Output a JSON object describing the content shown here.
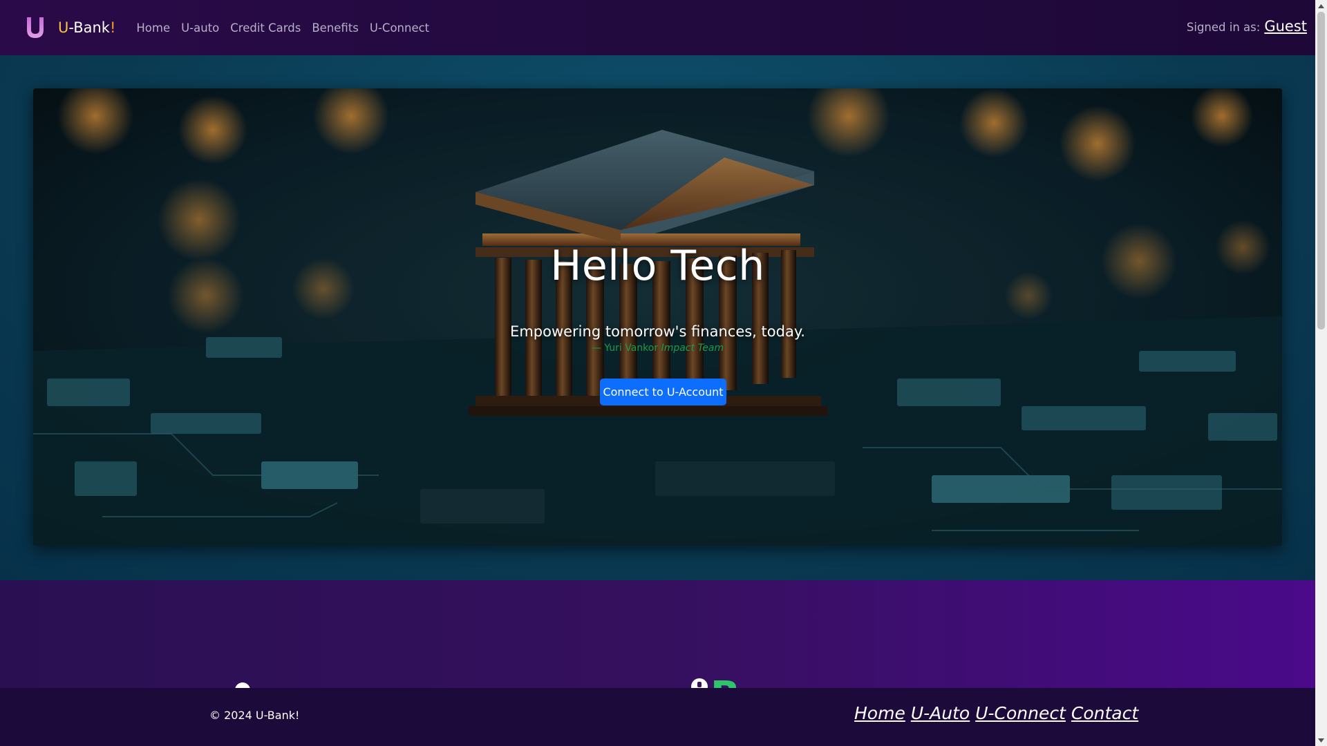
{
  "navbar": {
    "brand_prefix": "U",
    "brand_middle": "-Bank",
    "brand_suffix": "!",
    "links": [
      {
        "label": "Home"
      },
      {
        "label": "U-auto"
      },
      {
        "label": "Credit Cards"
      },
      {
        "label": "Benefits"
      },
      {
        "label": "U-Connect"
      }
    ],
    "signed_in_label": "Signed in as:",
    "signed_in_user": "Guest"
  },
  "hero": {
    "title": "Hello Tech",
    "quote": "Empowering tomorrow's finances, today.",
    "attribution_dash": "— Yuri Vankor",
    "attribution_team": "Impact Team",
    "button_label": "Connect to U-Account"
  },
  "footer": {
    "copyright": "© 2024 U-Bank!",
    "links": [
      {
        "label": "Home"
      },
      {
        "label": "U-Auto"
      },
      {
        "label": "U-Connect"
      },
      {
        "label": "Contact"
      }
    ]
  },
  "colors": {
    "accent_button": "#0d6efd",
    "navbar_bg": "#240a42",
    "hero_section_bg": "#0a3a52",
    "footer_bg": "#1c0a3a",
    "attribution": "#1f9a4a",
    "lower_heading": "#2ec46a"
  },
  "icons": {
    "brand_logo": "u-letter-logo-icon",
    "lower_heading": "circle-badge-icon"
  }
}
